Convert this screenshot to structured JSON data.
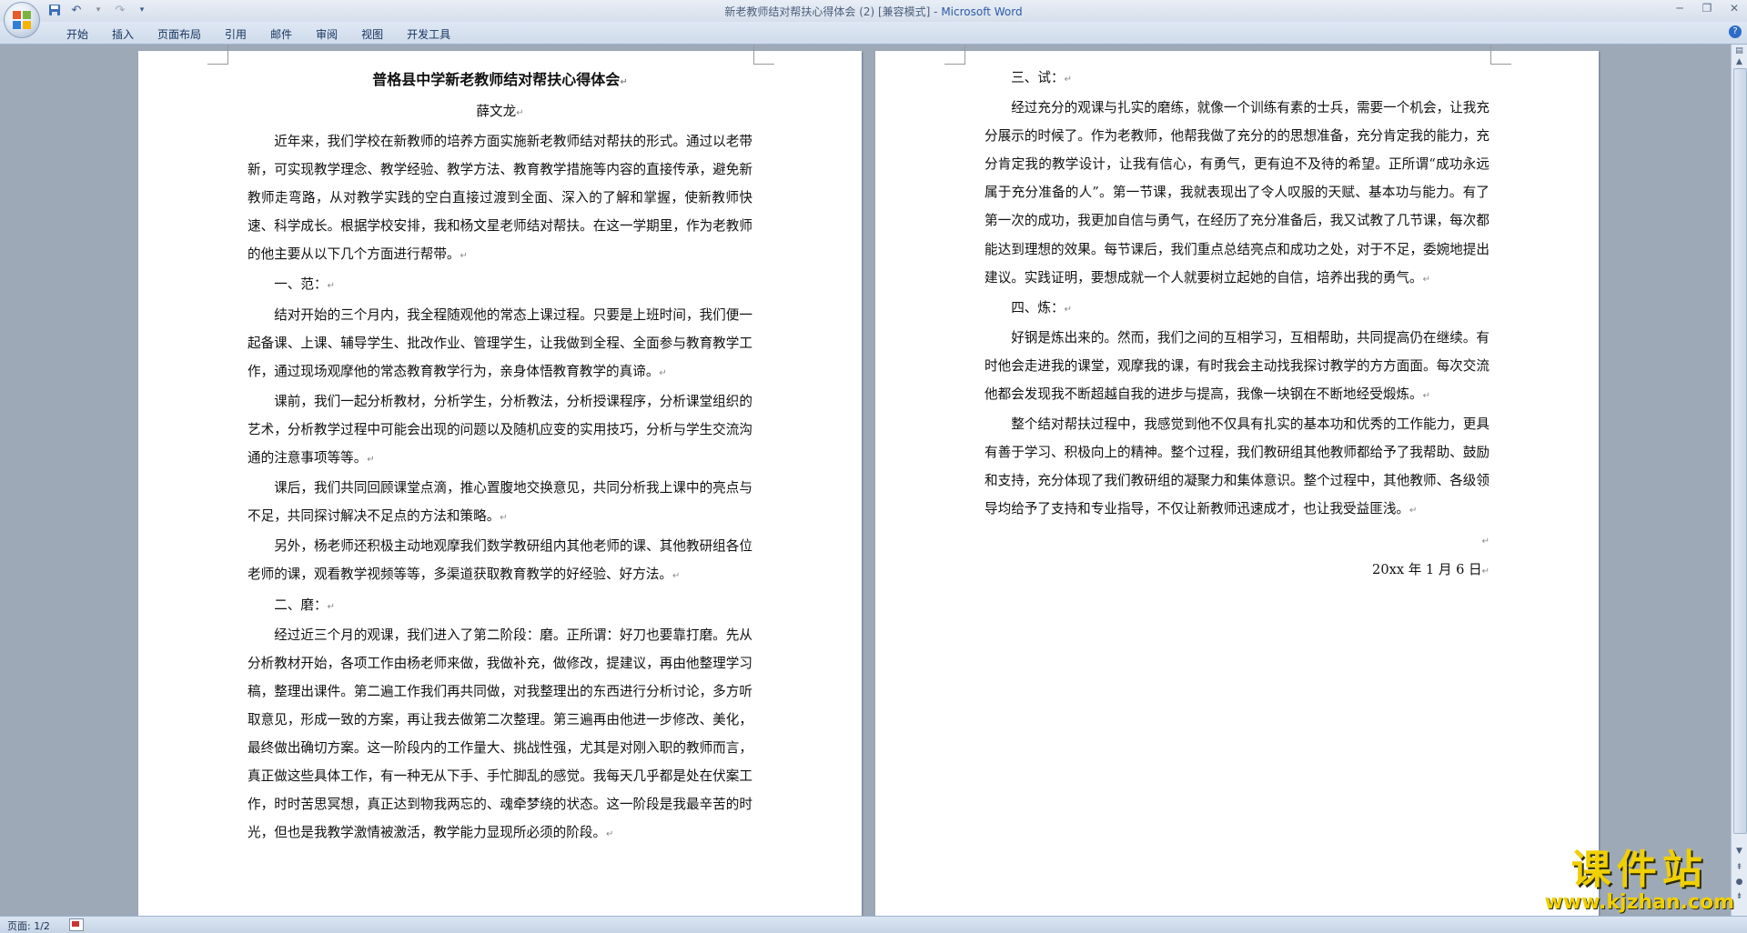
{
  "window": {
    "title": "新老教师结对帮扶心得体会 (2) [兼容模式] - ",
    "app": "Microsoft Word"
  },
  "ribbon": {
    "tabs": [
      "开始",
      "插入",
      "页面布局",
      "引用",
      "邮件",
      "审阅",
      "视图",
      "开发工具"
    ]
  },
  "status": {
    "page": "页面: 1/2"
  },
  "page1": {
    "title": "普格县中学新老教师结对帮扶心得体会",
    "author": "薛文龙",
    "intro": "近年来，我们学校在新教师的培养方面实施新老教师结对帮扶的形式。通过以老带新，可实现教学理念、教学经验、教学方法、教育教学措施等内容的直接传承，避免新教师走弯路，从对教学实践的空白直接过渡到全面、深入的了解和掌握，使新教师快速、科学成长。根据学校安排，我和杨文星老师结对帮扶。在这一学期里，作为老教师的他主要从以下几个方面进行帮带。",
    "h1": "一、范：",
    "p1": "结对开始的三个月内，我全程随观他的常态上课过程。只要是上班时间，我们便一起备课、上课、辅导学生、批改作业、管理学生，让我做到全程、全面参与教育教学工作，通过现场观摩他的常态教育教学行为，亲身体悟教育教学的真谛。",
    "p2": "课前，我们一起分析教材，分析学生，分析教法，分析授课程序，分析课堂组织的艺术，分析教学过程中可能会出现的问题以及随机应变的实用技巧，分析与学生交流沟通的注意事项等等。",
    "p3": "课后，我们共同回顾课堂点滴，推心置腹地交换意见，共同分析我上课中的亮点与不足，共同探讨解决不足点的方法和策略。",
    "p4": "另外，杨老师还积极主动地观摩我们数学教研组内其他老师的课、其他教研组各位老师的课，观看教学视频等等，多渠道获取教育教学的好经验、好方法。",
    "h2": "二、磨：",
    "p5": "经过近三个月的观课，我们进入了第二阶段：磨。正所谓：好刀也要靠打磨。先从分析教材开始，各项工作由杨老师来做，我做补充，做修改，提建议，再由他整理学习稿，整理出课件。第二遍工作我们再共同做，对我整理出的东西进行分析讨论，多方听取意见，形成一致的方案，再让我去做第二次整理。第三遍再由他进一步修改、美化，最终做出确切方案。这一阶段内的工作量大、挑战性强，尤其是对刚入职的教师而言，真正做这些具体工作，有一种无从下手、手忙脚乱的感觉。我每天几乎都是处在伏案工作，时时苦思冥想，真正达到物我两忘的、魂牵梦绕的状态。这一阶段是我最辛苦的时光，但也是我教学激情被激活，教学能力显现所必须的阶段。"
  },
  "page2": {
    "h3": "三、试：",
    "p6": "经过充分的观课与扎实的磨练，就像一个训练有素的士兵，需要一个机会，让我充分展示的时候了。作为老教师，他帮我做了充分的的思想准备，充分肯定我的能力，充分肯定我的教学设计，让我有信心，有勇气，更有迫不及待的希望。正所谓“成功永远属于充分准备的人”。第一节课，我就表现出了令人叹服的天赋、基本功与能力。有了第一次的成功，我更加自信与勇气，在经历了充分准备后，我又试教了几节课，每次都能达到理想的效果。每节课后，我们重点总结亮点和成功之处，对于不足，委婉地提出建议。实践证明，要想成就一个人就要树立起她的自信，培养出我的勇气。",
    "h4": "四、炼：",
    "p7": "好钢是炼出来的。然而，我们之间的互相学习，互相帮助，共同提高仍在继续。有时他会走进我的课堂，观摩我的课，有时我会主动找我探讨教学的方方面面。每次交流他都会发现我不断超越自我的进步与提高，我像一块钢在不断地经受煅炼。",
    "p8": "整个结对帮扶过程中，我感觉到他不仅具有扎实的基本功和优秀的工作能力，更具有善于学习、积极向上的精神。整个过程，我们教研组其他教师都给予了我帮助、鼓励和支持，充分体现了我们教研组的凝聚力和集体意识。整个过程中，其他教师、各级领导均给予了支持和专业指导，不仅让新教师迅速成才，也让我受益匪浅。",
    "date": "20xx 年 1 月 6 日"
  },
  "watermark": {
    "brand": "课件站",
    "url": "www.kjzhan.com"
  },
  "paragraph_mark": "↵"
}
